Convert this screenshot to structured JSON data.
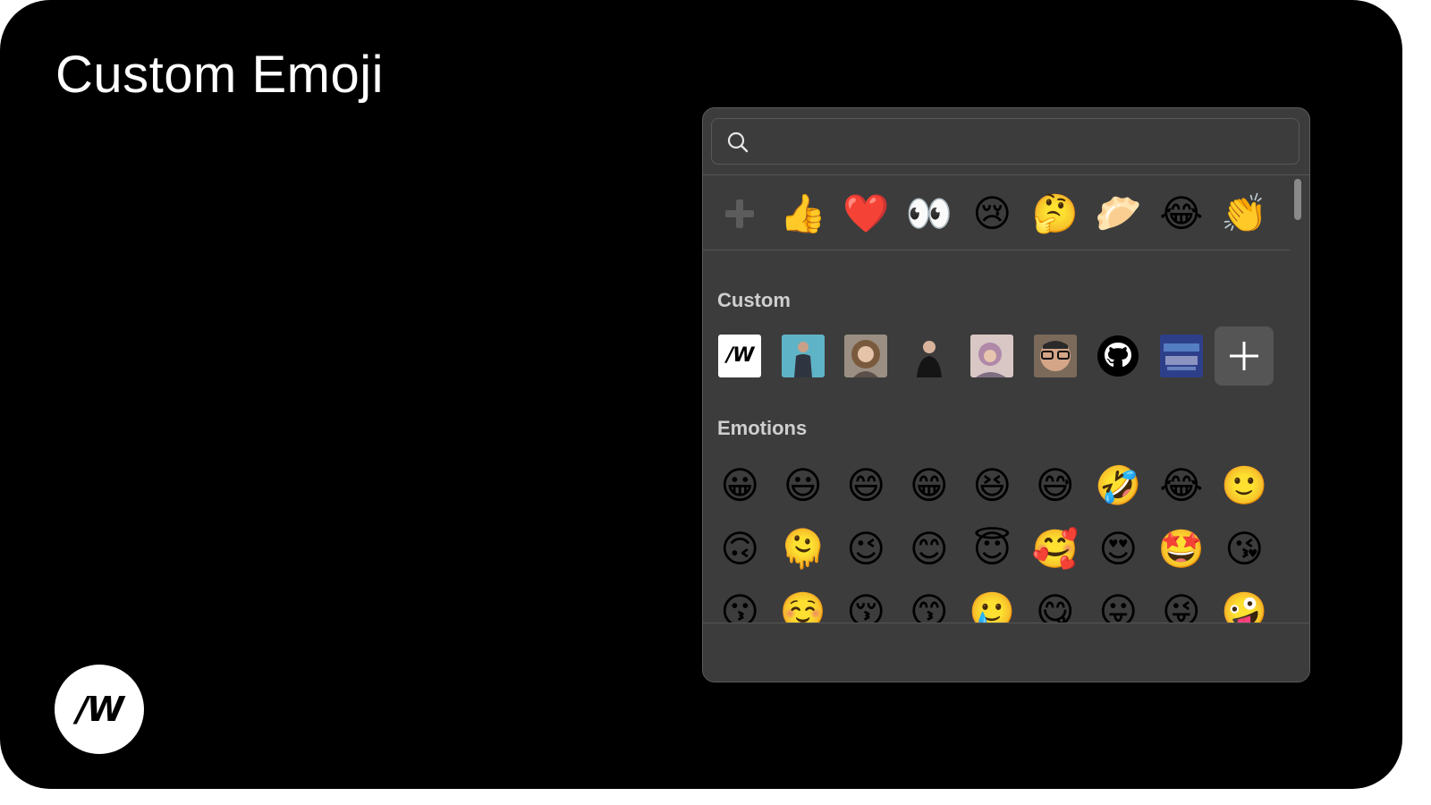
{
  "page": {
    "title": "Custom Emoji",
    "brand_logo_text": "/W"
  },
  "picker": {
    "search": {
      "placeholder": "",
      "value": "",
      "icon": "search-icon"
    },
    "recent": {
      "add_icon": "plus-icon",
      "emojis": [
        "👍",
        "❤️",
        "👀",
        "😢",
        "🤔",
        "🥟",
        "😂",
        "👏"
      ]
    },
    "sections": {
      "custom": {
        "title": "Custom",
        "items": [
          {
            "name": "w-logo",
            "label": "/W"
          },
          {
            "name": "person-presenter"
          },
          {
            "name": "person-curly-hair"
          },
          {
            "name": "person-standing"
          },
          {
            "name": "person-pink-hair"
          },
          {
            "name": "person-glasses"
          },
          {
            "name": "github-logo"
          },
          {
            "name": "thank-you"
          }
        ],
        "add_icon": "plus-icon"
      },
      "emotions": {
        "title": "Emotions",
        "rows": [
          [
            "😀",
            "😃",
            "😄",
            "😁",
            "😆",
            "😅",
            "🤣",
            "😂",
            "🙂"
          ],
          [
            "🙃",
            "🫠",
            "😉",
            "😊",
            "😇",
            "🥰",
            "😍",
            "🤩",
            "😘"
          ],
          [
            "😗",
            "☺️",
            "😚",
            "😙",
            "🥲",
            "😋",
            "😛",
            "😜",
            "🤪"
          ]
        ]
      }
    }
  }
}
